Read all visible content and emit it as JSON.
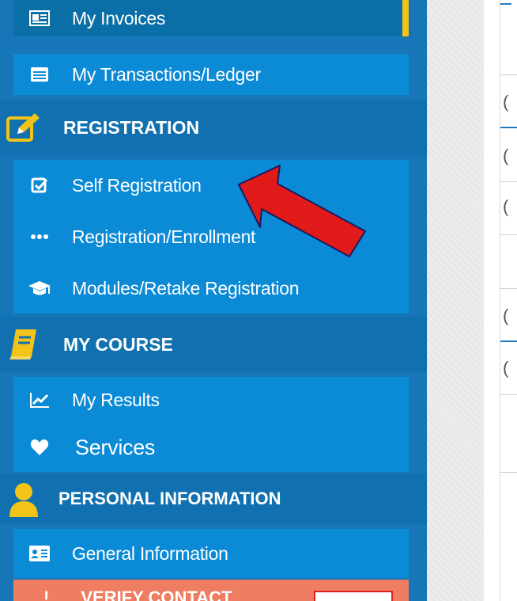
{
  "sidebar": {
    "items": [
      {
        "label": "My Invoices",
        "icon": "invoice-icon"
      },
      {
        "label": "My Transactions/Ledger",
        "icon": "ledger-icon"
      },
      {
        "label": "Self Registration",
        "icon": "checkbox-icon"
      },
      {
        "label": "Registration/Enrollment",
        "icon": "dots-icon"
      },
      {
        "label": "Modules/Retake Registration",
        "icon": "graduation-cap-icon"
      },
      {
        "label": "My Results",
        "icon": "line-chart-icon"
      },
      {
        "label": "Services",
        "icon": "heart-icon"
      },
      {
        "label": "General Information",
        "icon": "id-card-icon"
      }
    ],
    "sections": [
      {
        "label": "REGISTRATION",
        "icon": "pencil-edit-icon"
      },
      {
        "label": "MY COURSE",
        "icon": "book-icon"
      },
      {
        "label": "PERSONAL INFORMATION",
        "icon": "person-icon"
      }
    ],
    "verify_label": "VERIFY CONTACT",
    "active_item": "My Invoices"
  },
  "content_fragments": [
    "(",
    "(",
    "(",
    "(",
    "("
  ],
  "colors": {
    "sidebar_bg": "#1776b8",
    "item_bg": "#0b8ad6",
    "section_bg": "#1171b0",
    "active_bar": "#f2c319",
    "warning_bg": "#ee7d62",
    "annotation_arrow": "#e11a1a"
  }
}
